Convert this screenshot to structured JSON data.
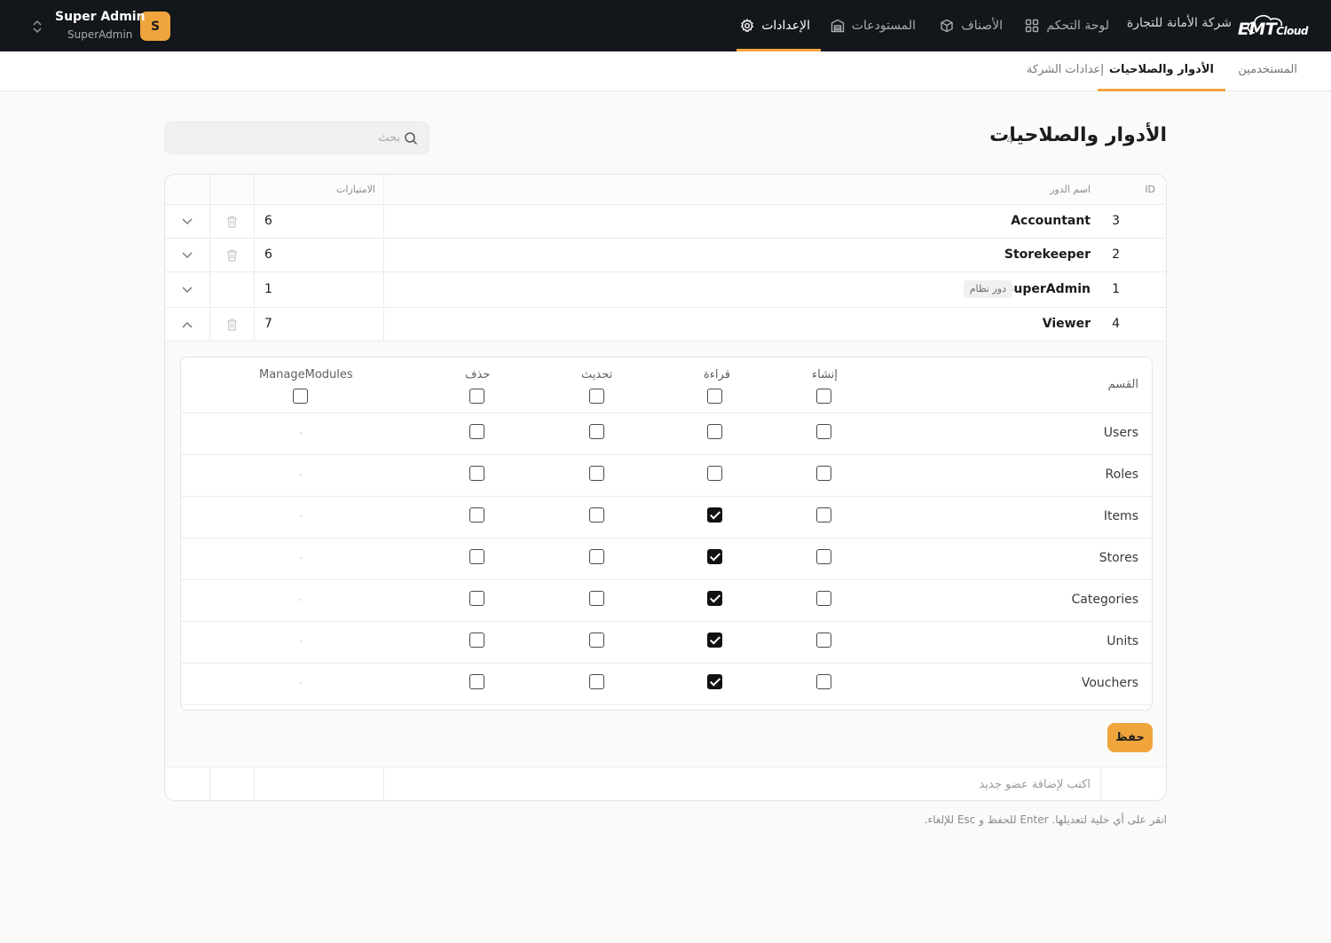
{
  "topbar": {
    "logo_main": "EMT",
    "logo_sub": "Cloud",
    "company": "شركة الأمانة للتجارة",
    "nav": [
      {
        "label": "لوحة التحكم",
        "icon": "grid-icon"
      },
      {
        "label": "الأصناف",
        "icon": "box-icon"
      },
      {
        "label": "المستودعات",
        "icon": "warehouse-icon"
      },
      {
        "label": "الإعدادات",
        "icon": "gear-icon",
        "active": true
      }
    ],
    "user": {
      "initial": "S",
      "name": "Super Admin",
      "role": "SuperAdmin"
    }
  },
  "subtabs": [
    {
      "label": "المستخدمين"
    },
    {
      "label": "الأدوار والصلاحيات",
      "active": true
    },
    {
      "label": "إعدادات الشركة"
    }
  ],
  "page": {
    "title": "الأدوار والصلاحيات",
    "count": "4"
  },
  "search": {
    "placeholder": "بحث",
    "value": ""
  },
  "table": {
    "headers": {
      "id": "ID",
      "name": "اسم الدور",
      "privileges": "الامتيازات"
    },
    "rows": [
      {
        "id": "3",
        "name": "Accountant",
        "privileges": "6"
      },
      {
        "id": "2",
        "name": "Storekeeper",
        "privileges": "6"
      },
      {
        "id": "1",
        "name": "SuperAdmin",
        "privileges": "1",
        "badge": "دور نظام"
      },
      {
        "id": "4",
        "name": "Viewer",
        "privileges": "7",
        "expanded": true
      }
    ],
    "new_row_placeholder": "اكتب لإضافة عضو جديد"
  },
  "permissions": {
    "headers": {
      "section": "القسم",
      "create": "إنشاء",
      "read": "قراءة",
      "update": "تحديث",
      "delete": "حذف",
      "manage": "ManageModules"
    },
    "rows": [
      {
        "section": "Users",
        "create": false,
        "read": false,
        "update": false,
        "delete": false,
        "manage": "-"
      },
      {
        "section": "Roles",
        "create": false,
        "read": false,
        "update": false,
        "delete": false,
        "manage": "-"
      },
      {
        "section": "Items",
        "create": false,
        "read": true,
        "update": false,
        "delete": false,
        "manage": "-"
      },
      {
        "section": "Stores",
        "create": false,
        "read": true,
        "update": false,
        "delete": false,
        "manage": "-"
      },
      {
        "section": "Categories",
        "create": false,
        "read": true,
        "update": false,
        "delete": false,
        "manage": "-"
      },
      {
        "section": "Units",
        "create": false,
        "read": true,
        "update": false,
        "delete": false,
        "manage": "-"
      },
      {
        "section": "Vouchers",
        "create": false,
        "read": true,
        "update": false,
        "delete": false,
        "manage": "-"
      }
    ],
    "save_label": "حفظ"
  },
  "hint": "انقر على أي خلية لتعديلها. Enter للحفظ و Esc للإلغاء."
}
